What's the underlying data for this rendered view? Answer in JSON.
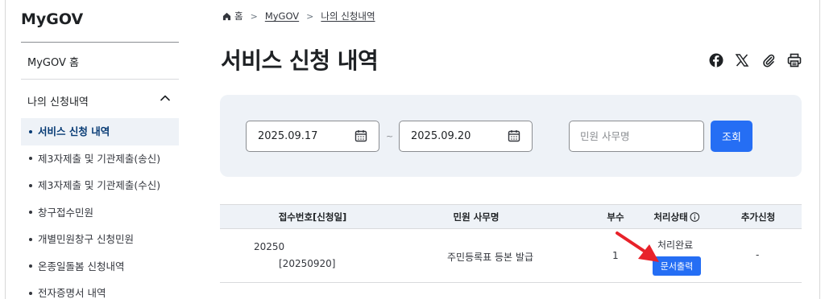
{
  "logo": "MyGOV",
  "sidebar": {
    "home": "MyGOV 홈",
    "group": "나의 신청내역",
    "items": [
      {
        "label": "서비스 신청 내역",
        "active": true
      },
      {
        "label": "제3자제출 및 기관제출(송신)"
      },
      {
        "label": "제3자제출 및 기관제출(수신)"
      },
      {
        "label": "창구접수민원"
      },
      {
        "label": "개별민원창구 신청민원"
      },
      {
        "label": "온종일돌봄 신청내역"
      },
      {
        "label": "전자증명서 내역"
      }
    ]
  },
  "breadcrumb": [
    "홈",
    "MyGOV",
    "나의 신청내역"
  ],
  "page_title": "서비스 신청 내역",
  "share_icons": [
    "facebook-icon",
    "x-icon",
    "link-icon",
    "print-icon"
  ],
  "search": {
    "start_date": "2025.09.17",
    "separator": "~",
    "end_date": "2025.09.20",
    "service_placeholder": "민원 사무명",
    "button": "조회"
  },
  "table": {
    "headers": [
      "접수번호[신청일]",
      "민원 사무명",
      "부수",
      "처리상태",
      "추가신청"
    ],
    "rows": [
      {
        "receipt_no": "20250",
        "apply_date": "[20250920]",
        "service": "주민등록표 등본 발급",
        "copies": "1",
        "status": "처리완료",
        "action": "문서출력",
        "extra": "-"
      }
    ]
  },
  "colors": {
    "accent": "#256ef4",
    "panel": "#eef2f7",
    "annotation_arrow": "#e8222a"
  }
}
